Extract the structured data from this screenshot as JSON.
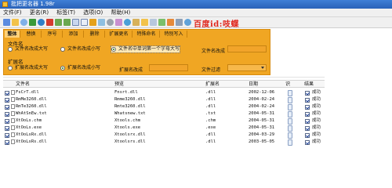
{
  "window": {
    "title": "批把更名器 1.98r"
  },
  "menu": [
    "文件(F)",
    "更名(R)",
    "标签(T)",
    "选项(O)",
    "帮助(H)"
  ],
  "toolbar": {
    "watermark": "百度id:吱蝶"
  },
  "tabs": [
    "整体",
    "替换",
    "序号",
    "添加",
    "删除",
    "扩展更名",
    "特殊命名",
    "特别写入"
  ],
  "filename_group": {
    "label": "文件名",
    "options": [
      "文件名改成大写",
      "文件名改成小写",
      "文件名中单词第一个字母大写"
    ],
    "selected": 2,
    "field_label": "文件名改成"
  },
  "ext_group": {
    "label": "扩展名",
    "options": [
      "扩展名改成大写",
      "扩展名改成小写",
      "扩展名改成"
    ],
    "selected": 1,
    "filter_label": "文件过滤"
  },
  "table": {
    "headers": [
      "文件名",
      "预览",
      "扩展名",
      "日期",
      "识",
      "结果"
    ],
    "rows": [
      {
        "name": "FsCrT.dll",
        "preview": "Fnsrt.dll",
        "ext": ".dll",
        "date": "2002-12-06",
        "result": "成功"
      },
      {
        "name": "RmMe3260.dll",
        "preview": "Rmme3260.dll",
        "ext": ".dll",
        "date": "2004-02-24",
        "result": "成功"
      },
      {
        "name": "RmTe3260.dll",
        "preview": "Rmte3260.dll",
        "ext": ".dll",
        "date": "2004-02-24",
        "result": "成功"
      },
      {
        "name": "WhAtSnEw.txt",
        "preview": "Whatsnew.txt",
        "ext": ".txt",
        "date": "2004-05-31",
        "result": "成功"
      },
      {
        "name": "XtOoLs.chm",
        "preview": "Xtools.chm",
        "ext": ".chm",
        "date": "2004-05-31",
        "result": "成功"
      },
      {
        "name": "XtOoLs.exe",
        "preview": "Xtools.exe",
        "ext": ".exe",
        "date": "2004-05-31",
        "result": "成功"
      },
      {
        "name": "XtOoLsRx.dll",
        "preview": "Xtoolsrx.dll",
        "ext": ".dll",
        "date": "2004-03-29",
        "result": "成功"
      },
      {
        "name": "XtOoLsRs.dll",
        "preview": "Xtoolsrs.dll",
        "ext": ".dll",
        "date": "2003-05-05",
        "result": "成功"
      }
    ]
  },
  "colors": {
    "panel": "#f0a623",
    "tab_active": "#ffd27a",
    "watermark": "#e0261c",
    "titlebar": "#2a62b8"
  }
}
